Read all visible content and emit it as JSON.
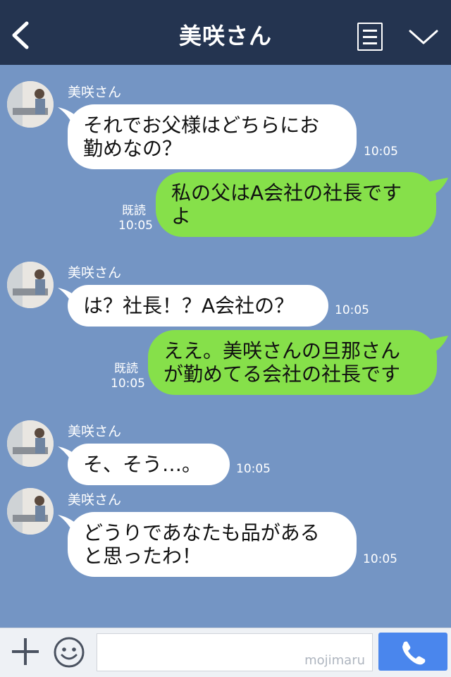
{
  "header": {
    "title": "美咲さん",
    "back_icon": "chevron-left-icon",
    "menu_icon": "menu-icon",
    "expand_icon": "chevron-down-icon"
  },
  "messages": [
    {
      "side": "in",
      "sender": "美咲さん",
      "lines": [
        "それでお父様はどちらにお",
        "勤めなの？"
      ],
      "time": "10:05"
    },
    {
      "side": "out",
      "lines": [
        "私の父はA会社の社長です",
        "よ"
      ],
      "read": "既読",
      "time": "10:05"
    },
    {
      "side": "in",
      "sender": "美咲さん",
      "lines": [
        "は？社長！？A会社の？"
      ],
      "time": "10:05"
    },
    {
      "side": "out",
      "lines": [
        "ええ。美咲さんの旦那さん",
        "が勤めてる会社の社長です"
      ],
      "read": "既読",
      "time": "10:05"
    },
    {
      "side": "in",
      "sender": "美咲さん",
      "lines": [
        "そ、そう…。"
      ],
      "time": "10:05"
    },
    {
      "side": "in",
      "sender": "美咲さん",
      "lines": [
        "どうりであなたも品がある",
        "と思ったわ！"
      ],
      "time": "10:05"
    }
  ],
  "footer": {
    "watermark": "mojimaru",
    "plus_icon": "plus-icon",
    "sticker_icon": "smiley-icon",
    "call_icon": "phone-icon"
  },
  "colors": {
    "background": "#7495c4",
    "header": "#243450",
    "bubble_in": "#ffffff",
    "bubble_out": "#86e04a",
    "call_button": "#4a86ed"
  }
}
